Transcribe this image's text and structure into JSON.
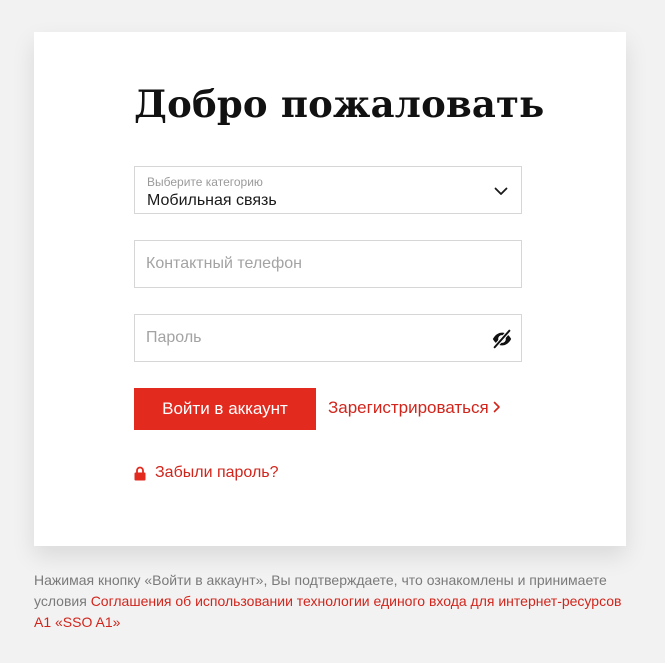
{
  "login": {
    "title": "Добро пожаловать",
    "category": {
      "caption": "Выберите категорию",
      "value": "Мобильная связь",
      "icon": "chevron-down-icon"
    },
    "phone": {
      "placeholder": "Контактный телефон",
      "value": ""
    },
    "password": {
      "placeholder": "Пароль",
      "value": "",
      "toggle_icon": "eye-off-icon"
    },
    "login_button": "Войти в аккаунт",
    "register_link": "Зарегистрироваться",
    "register_icon": "chevron-right-icon",
    "forgot_link": "Забыли пароль?",
    "forgot_icon": "lock-icon"
  },
  "footer": {
    "text": "Нажимая кнопку «Войти в аккаунт», Вы подтверждаете, что ознакомлены и принимаете условия ",
    "link": "Соглашения об использовании технологии единого входа для интернет-ресурсов А1 «SSO A1»"
  },
  "colors": {
    "accent": "#e22a1f",
    "link": "#d1251c",
    "background": "#f2f2f2",
    "card": "#ffffff"
  }
}
